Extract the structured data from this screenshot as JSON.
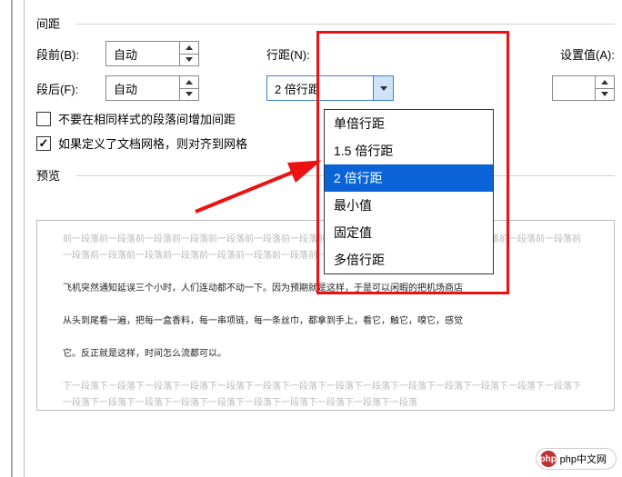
{
  "section_spacing_title": "间距",
  "section_preview_title": "预览",
  "labels": {
    "before": "段前(B):",
    "after": "段后(F):",
    "line_spacing": "行距(N):",
    "set_value": "设置值(A):"
  },
  "spacing": {
    "before_value": "自动",
    "after_value": "自动",
    "line_spacing_value": "2 倍行距",
    "set_value_value": ""
  },
  "line_spacing_options": [
    "单倍行距",
    "1.5 倍行距",
    "2 倍行距",
    "最小值",
    "固定值",
    "多倍行距"
  ],
  "line_spacing_selected_index": 2,
  "checkboxes": {
    "no_space_same_style": {
      "label": "不要在相同样式的段落间增加间距",
      "checked": false
    },
    "snap_to_grid": {
      "label": "如果定义了文档网格，则对齐到网格",
      "checked": true
    }
  },
  "preview": {
    "ghost_before": "前一段落前一段落前一段落前一段落前一段落前一段落前一段落前一段落前一段落前一段落前一段落前一段落前一段落前一段落前一段落前一段落前一段落前一段落前一段落前一段落前一段落前一段落前一段落",
    "body_line1": "飞机突然通知延误三个小时，人们连动都不动一下。因为预期就是这样，于是可以闲暇的把机场商店",
    "body_line2": "从头到尾看一遍，把每一盒香料，每一串项链，每一条丝巾，都拿到手上，看它，触它，嗅它，感觉",
    "body_line3": "它。反正就是这样，时间怎么流都可以。",
    "ghost_after": "下一段落下一段落下一段落下一段落下一段落下一段落下一段落下一段落下一段落下一段落下一段落下一段落下一段落下一段落下一段落下一段落下一段落下一段落下一段落下一段落下一段落下一段落下一段落下一段落"
  },
  "watermark": "php中文网"
}
